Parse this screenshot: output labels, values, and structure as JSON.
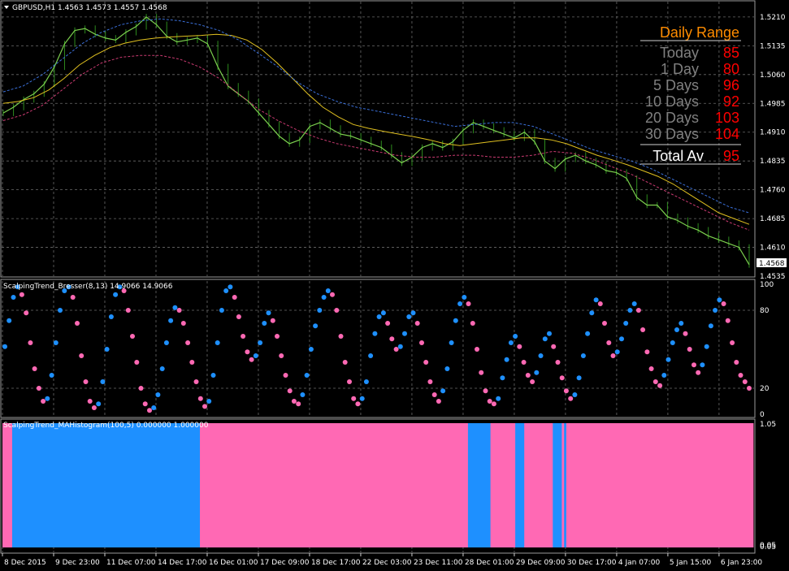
{
  "chart_data": [
    {
      "type": "candlestick",
      "title": "GBPUSD,H1  1.4563 1.4573 1.4557 1.4568",
      "current_price": "1.4568",
      "ylim": [
        1.4535,
        1.525
      ],
      "y_ticks": [
        "1.5210",
        "1.5135",
        "1.5060",
        "1.4985",
        "1.4910",
        "1.4835",
        "1.4760",
        "1.4685",
        "1.4610",
        "1.4535"
      ],
      "grid": true,
      "series": [
        {
          "key": "price",
          "color": "#2e8b1e",
          "values": [
            1.496,
            1.4975,
            1.4995,
            1.501,
            1.5035,
            1.508,
            1.514,
            1.5175,
            1.518,
            1.5165,
            1.5155,
            1.515,
            1.517,
            1.5185,
            1.521,
            1.519,
            1.516,
            1.5145,
            1.515,
            1.5155,
            1.514,
            1.508,
            1.503,
            1.501,
            1.499,
            1.496,
            1.493,
            1.49,
            1.488,
            1.489,
            1.4925,
            1.4935,
            1.492,
            1.4905,
            1.49,
            1.489,
            1.488,
            1.487,
            1.485,
            1.483,
            1.4845,
            1.487,
            1.488,
            1.487,
            1.4885,
            1.4915,
            1.4935,
            1.4925,
            1.4915,
            1.4905,
            1.4895,
            1.491,
            1.4885,
            1.4835,
            1.4815,
            1.484,
            1.485,
            1.4835,
            1.4825,
            1.481,
            1.4805,
            1.479,
            1.474,
            1.472,
            1.472,
            1.469,
            1.468,
            1.4665,
            1.4655,
            1.464,
            1.463,
            1.462,
            1.461,
            1.4565
          ]
        },
        {
          "key": "ma",
          "color": "#e0c020",
          "values": [
            1.4985,
            1.499,
            1.5,
            1.502,
            1.505,
            1.5085,
            1.511,
            1.513,
            1.5142,
            1.515,
            1.5155,
            1.5158,
            1.516,
            1.5162,
            1.5165,
            1.5162,
            1.515,
            1.5125,
            1.509,
            1.505,
            1.501,
            1.4975,
            1.495,
            1.493,
            1.492,
            1.4912,
            1.4905,
            1.4898,
            1.489,
            1.488,
            1.4875,
            1.488,
            1.4885,
            1.489,
            1.4895,
            1.4895,
            1.489,
            1.488,
            1.4865,
            1.485,
            1.4838,
            1.4825,
            1.481,
            1.4795,
            1.4775,
            1.475,
            1.4725,
            1.47,
            1.4685,
            1.467
          ]
        },
        {
          "key": "upper_band",
          "color": "#3a6fd8",
          "values": [
            1.5015,
            1.503,
            1.506,
            1.51,
            1.514,
            1.517,
            1.519,
            1.52,
            1.5205,
            1.52,
            1.519,
            1.5175,
            1.515,
            1.5115,
            1.508,
            1.504,
            1.501,
            1.499,
            1.4975,
            1.4965,
            1.4955,
            1.4945,
            1.4935,
            1.4925,
            1.493,
            1.4935,
            1.4935,
            1.4925,
            1.4905,
            1.4885,
            1.4865,
            1.485,
            1.4835,
            1.4815,
            1.479,
            1.4765,
            1.474,
            1.4715,
            1.47
          ]
        },
        {
          "key": "lower_band",
          "color": "#c83a70",
          "values": [
            1.494,
            1.4955,
            1.498,
            1.502,
            1.506,
            1.509,
            1.5105,
            1.511,
            1.511,
            1.51,
            1.508,
            1.505,
            1.501,
            1.497,
            1.494,
            1.4915,
            1.4895,
            1.488,
            1.487,
            1.486,
            1.485,
            1.4845,
            1.4845,
            1.485,
            1.485,
            1.4845,
            1.4845,
            1.485,
            1.486,
            1.4855,
            1.484,
            1.482,
            1.48,
            1.4775,
            1.475,
            1.4725,
            1.47,
            1.4675,
            1.4655
          ]
        }
      ]
    },
    {
      "type": "scatter",
      "title": "ScalpingTrend_Bresser(8,13) 14.9066 14.9066",
      "ylim": [
        0,
        100
      ],
      "y_ticks": [
        "100",
        "80",
        "20",
        "0"
      ],
      "series": [
        {
          "name": "",
          "color": "#1e90ff",
          "key": "up"
        },
        {
          "name": "",
          "color": "#ff69b4",
          "key": "down"
        }
      ],
      "values": [
        52,
        72,
        90,
        98,
        92,
        78,
        55,
        35,
        20,
        10,
        12,
        30,
        55,
        80,
        95,
        98,
        90,
        70,
        45,
        25,
        10,
        5,
        8,
        25,
        50,
        75,
        92,
        98,
        95,
        80,
        60,
        40,
        20,
        8,
        3,
        5,
        15,
        35,
        55,
        72,
        82,
        80,
        70,
        55,
        40,
        25,
        12,
        6,
        10,
        30,
        55,
        80,
        95,
        98,
        90,
        75,
        60,
        48,
        42,
        45,
        55,
        70,
        78,
        72,
        60,
        45,
        30,
        18,
        10,
        8,
        15,
        30,
        50,
        68,
        80,
        90,
        95,
        92,
        80,
        60,
        40,
        25,
        12,
        8,
        12,
        25,
        45,
        62,
        75,
        78,
        70,
        58,
        50,
        52,
        62,
        75,
        78,
        70,
        55,
        40,
        25,
        15,
        10,
        18,
        35,
        55,
        72,
        85,
        90,
        85,
        70,
        50,
        32,
        18,
        10,
        8,
        12,
        28,
        42,
        55,
        60,
        52,
        40,
        30,
        25,
        32,
        45,
        58,
        62,
        52,
        40,
        28,
        18,
        12,
        15,
        28,
        45,
        62,
        78,
        88,
        85,
        70,
        55,
        45,
        48,
        58,
        70,
        80,
        85,
        80,
        65,
        48,
        35,
        25,
        22,
        30,
        42,
        55,
        65,
        70,
        62,
        50,
        38,
        32,
        38,
        52,
        68,
        80,
        88,
        85,
        72,
        55,
        40,
        30,
        25,
        20
      ]
    },
    {
      "type": "histogram",
      "title": "ScalpingTrend_MAHistogram(100,5) 0.000000 1.000000",
      "ylim": [
        0,
        1.05
      ],
      "y_ticks": [
        "1.05",
        "0.05",
        "0.05"
      ],
      "segments": [
        {
          "fraction": 0.013,
          "color": "#ff69b4"
        },
        {
          "fraction": 0.25,
          "color": "#1e90ff"
        },
        {
          "fraction": 0.357,
          "color": "#ff69b4"
        },
        {
          "fraction": 0.03,
          "color": "#1e90ff"
        },
        {
          "fraction": 0.033,
          "color": "#ff69b4"
        },
        {
          "fraction": 0.012,
          "color": "#1e90ff"
        },
        {
          "fraction": 0.038,
          "color": "#ff69b4"
        },
        {
          "fraction": 0.012,
          "color": "#1e90ff"
        },
        {
          "fraction": 0.003,
          "color": "#ff69b4"
        },
        {
          "fraction": 0.003,
          "color": "#1e90ff"
        },
        {
          "fraction": 0.249,
          "color": "#ff69b4"
        }
      ]
    }
  ],
  "x_labels": [
    "8 Dec 2015",
    "9 Dec 23:00",
    "11 Dec 07:00",
    "14 Dec 17:00",
    "16 Dec 01:00",
    "17 Dec 09:00",
    "18 Dec 17:00",
    "22 Dec 03:00",
    "23 Dec 11:00",
    "28 Dec 01:00",
    "29 Dec 09:00",
    "30 Dec 17:00",
    "4 Jan 07:00",
    "5 Jan 15:00",
    "6 Jan 23:00"
  ],
  "daily_range": {
    "title": "Daily Range",
    "rows": [
      {
        "label": "Today",
        "value": "85"
      },
      {
        "label": "1 Day",
        "value": "80"
      },
      {
        "label": "5 Days",
        "value": "96"
      },
      {
        "label": "10 Days",
        "value": "92"
      },
      {
        "label": "20 Days",
        "value": "103"
      },
      {
        "label": "30 Days",
        "value": "104"
      }
    ],
    "total_label": "Total Av",
    "total_value": "95",
    "title_color": "#ff8c00",
    "label_color": "#808080",
    "value_color": "#ff0000",
    "total_label_color": "#ffffff"
  },
  "colors": {
    "background": "#000000",
    "grid": "#6a6a6a",
    "axis_text": "#ffffff"
  }
}
